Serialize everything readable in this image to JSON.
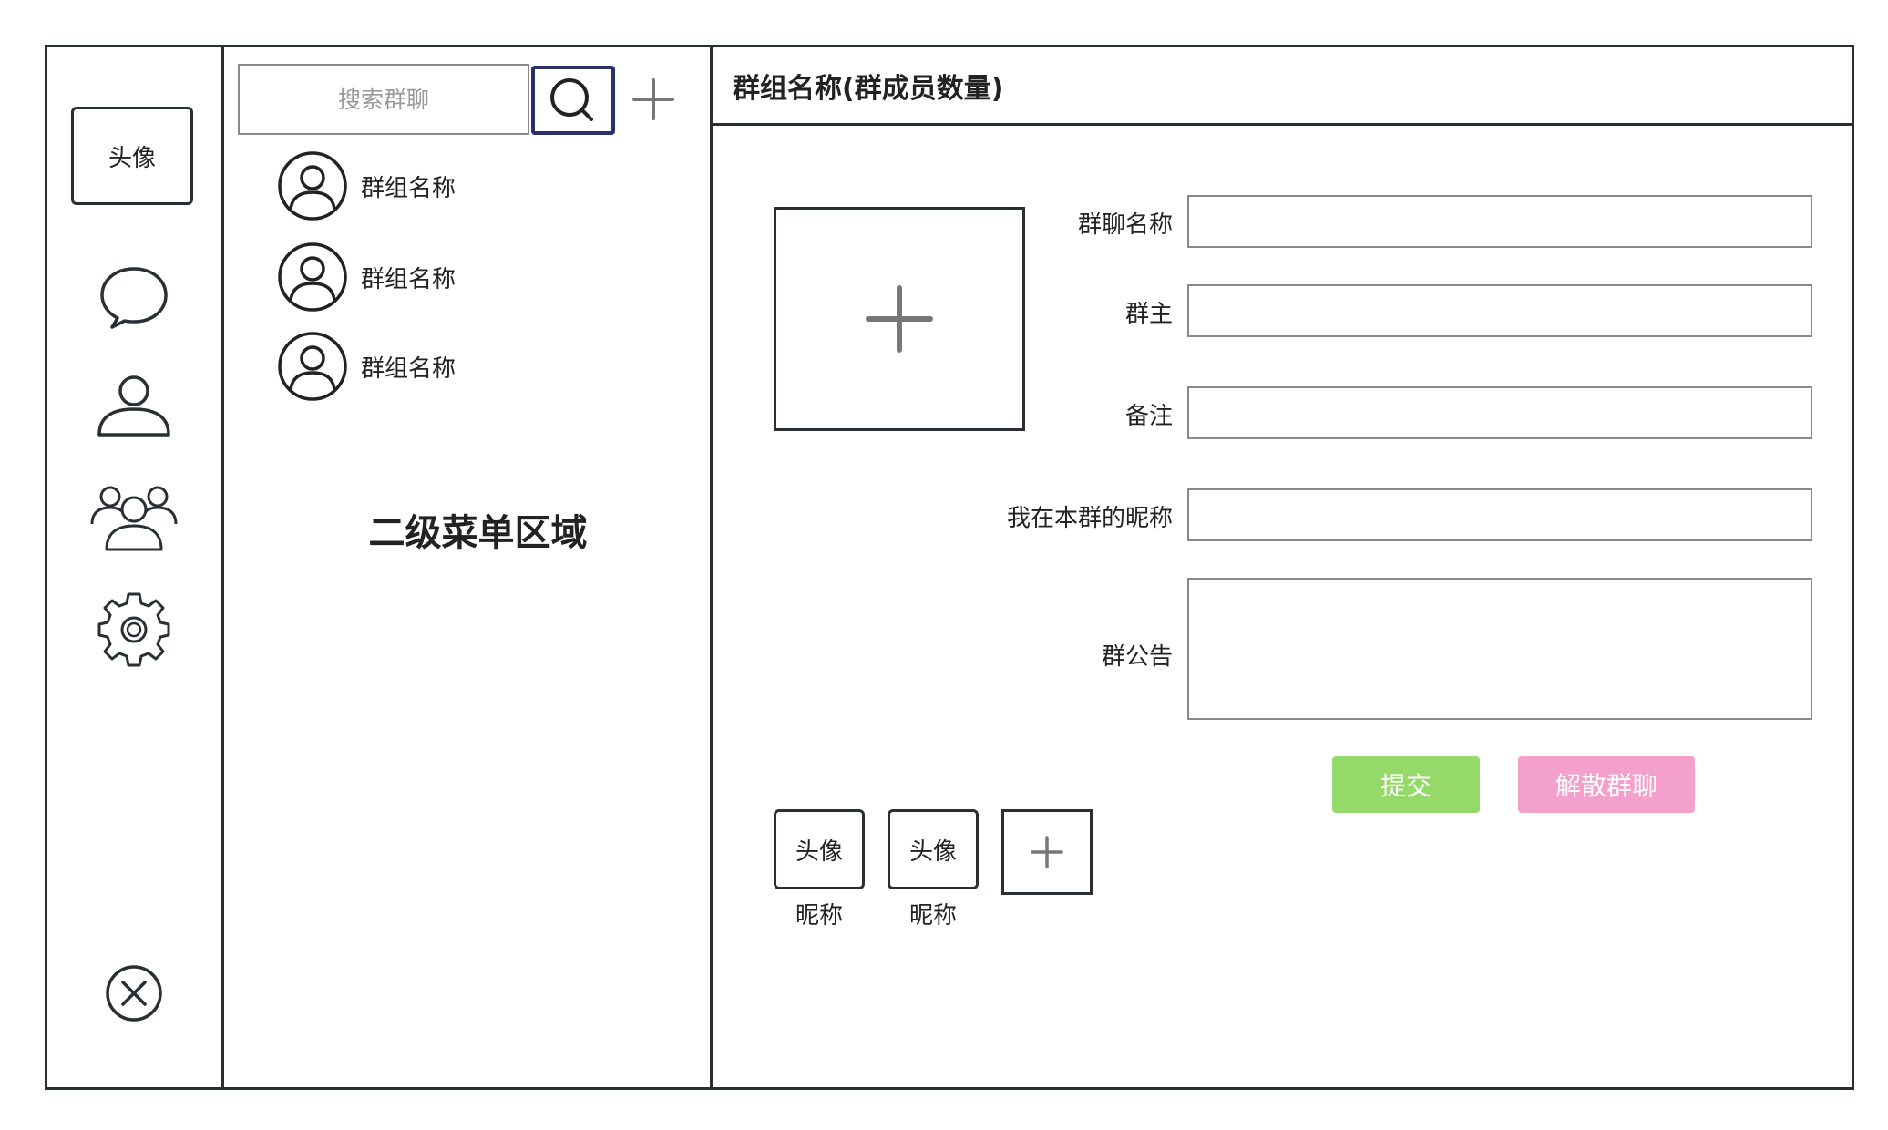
{
  "sidebar": {
    "avatar_label": "头像",
    "icons": [
      "chat-bubble-icon",
      "user-icon",
      "group-users-icon",
      "gear-icon",
      "close-circle-icon"
    ]
  },
  "secondary": {
    "search_placeholder": "搜索群聊",
    "groups": [
      {
        "name": "群组名称"
      },
      {
        "name": "群组名称"
      },
      {
        "name": "群组名称"
      }
    ],
    "area_label": "二级菜单区域"
  },
  "main": {
    "header_title": "群组名称(群成员数量)",
    "form": {
      "group_name_label": "群聊名称",
      "owner_label": "群主",
      "remark_label": "备注",
      "nickname_label": "我在本群的昵称",
      "announcement_label": "群公告"
    },
    "buttons": {
      "submit": "提交",
      "dismiss": "解散群聊"
    },
    "members": [
      {
        "avatar_label": "头像",
        "name": "昵称"
      },
      {
        "avatar_label": "头像",
        "name": "昵称"
      }
    ]
  },
  "colors": {
    "border": "#2a2f36",
    "search_border": "#2a2f6e",
    "submit": "#95d96a",
    "dismiss": "#f3a0cc"
  }
}
